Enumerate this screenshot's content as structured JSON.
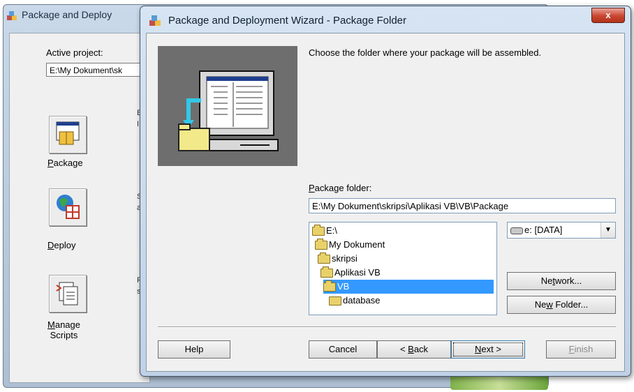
{
  "background_window": {
    "title": "Package and Deploy",
    "active_project_label": "Active project:",
    "active_project_value": "E:\\My Dokument\\sk",
    "buttons": [
      {
        "label": "Package"
      },
      {
        "label": "Deploy"
      },
      {
        "label": "Manage Scripts"
      }
    ],
    "side_letters": [
      "B",
      "I",
      "S",
      "a",
      "R",
      "s"
    ]
  },
  "dialog": {
    "title": "Package and Deployment Wizard - Package Folder",
    "close_label": "x",
    "instruction": "Choose the folder where your package will be assembled.",
    "package_folder_label": "Package folder:",
    "package_folder_value": "E:\\My Dokument\\skripsi\\Aplikasi VB\\VB\\Package",
    "folder_tree": [
      {
        "label": "E:\\",
        "icon": "drive-folder-icon"
      },
      {
        "label": "My Dokument",
        "icon": "open-folder-icon"
      },
      {
        "label": "skripsi",
        "icon": "open-folder-icon"
      },
      {
        "label": "Aplikasi VB",
        "icon": "open-folder-icon"
      },
      {
        "label": "VB",
        "icon": "open-folder-icon",
        "selected": true
      },
      {
        "label": "database",
        "icon": "folder-icon"
      }
    ],
    "drive_select": "e: [DATA]",
    "buttons": {
      "network": "Network...",
      "new_folder": "New Folder...",
      "help": "Help",
      "cancel": "Cancel",
      "back": "< Back",
      "next": "Next >",
      "finish": "Finish"
    }
  }
}
